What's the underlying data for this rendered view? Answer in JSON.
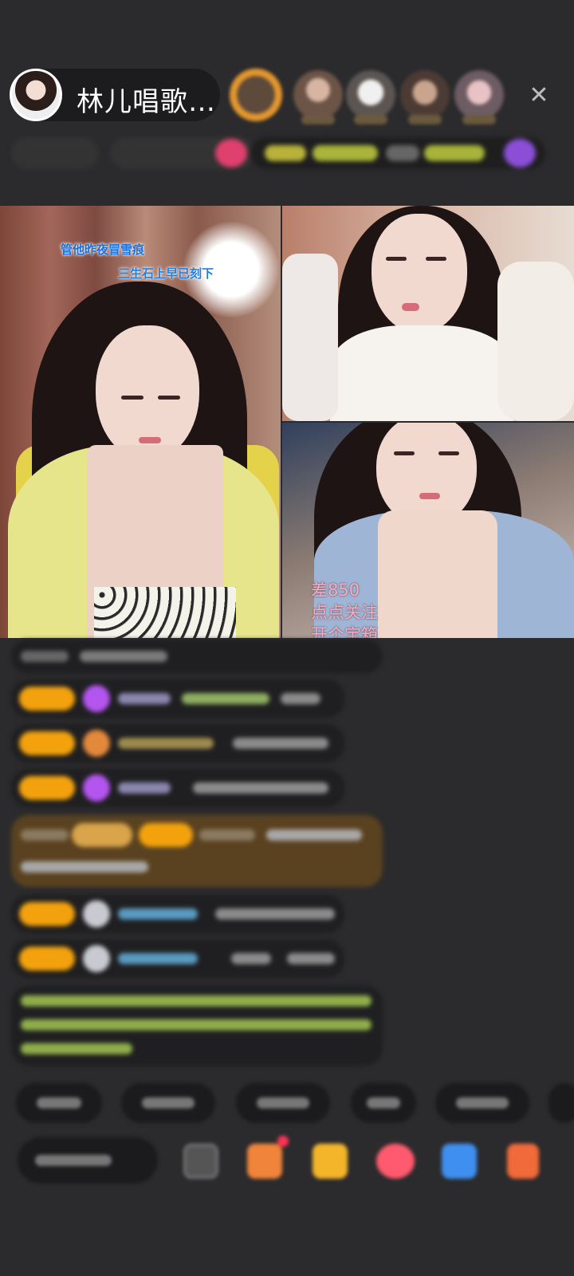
{
  "header": {
    "host_name": "林儿唱歌…",
    "close_glyph": "✕"
  },
  "videos": {
    "left": {
      "lyric_line1": "管他昨夜冒雪痕",
      "lyric_line2": "三生石上早已刻下",
      "lyric_color1": "#1f6fd6",
      "lyric_color2": "#1f7fe0"
    },
    "bottom_right": {
      "overlay_line1": "差850",
      "overlay_line2": "点点关注",
      "overlay_line3": "开个宝箱"
    }
  },
  "colors": {
    "background": "#2b2b2d",
    "badge_gold": "#f3a20e",
    "diamond_purple": "#b455f0",
    "highlight_msg": "#5a4220",
    "system_msg_green": "#b7d96a"
  }
}
